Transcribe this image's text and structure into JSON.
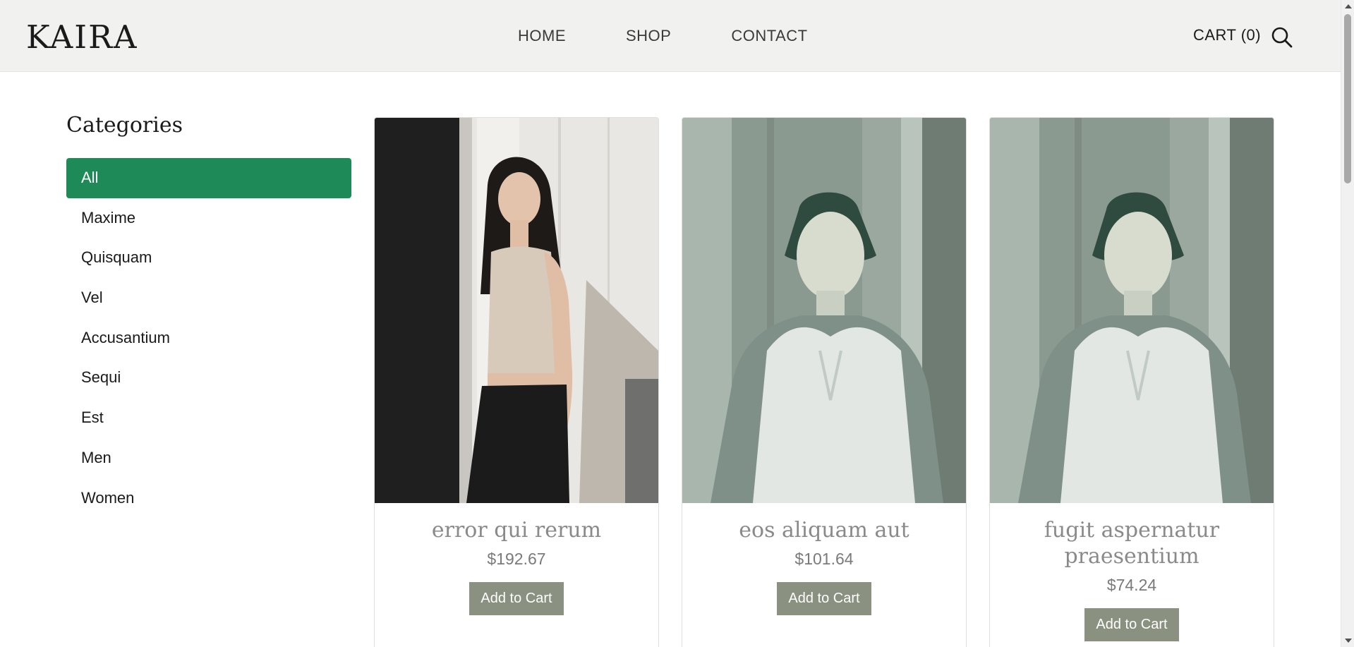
{
  "header": {
    "logo": "KAIRA",
    "nav": [
      "HOME",
      "SHOP",
      "CONTACT"
    ],
    "cart_label": "CART (0)"
  },
  "sidebar": {
    "title": "Categories",
    "items": [
      "All",
      "Maxime",
      "Quisquam",
      "Vel",
      "Accusantium",
      "Sequi",
      "Est",
      "Men",
      "Women"
    ],
    "active_item": "All"
  },
  "products": [
    {
      "title": "error qui rerum",
      "price": "$192.67",
      "button": "Add to Cart"
    },
    {
      "title": "eos aliquam aut",
      "price": "$101.64",
      "button": "Add to Cart"
    },
    {
      "title": "fugit aspernatur praesentium",
      "price": "$74.24",
      "button": "Add to Cart"
    }
  ],
  "colors": {
    "active_category": "#1e8a57",
    "add_to_cart_bg": "#8a9180",
    "header_bg": "#f1f1ef"
  }
}
